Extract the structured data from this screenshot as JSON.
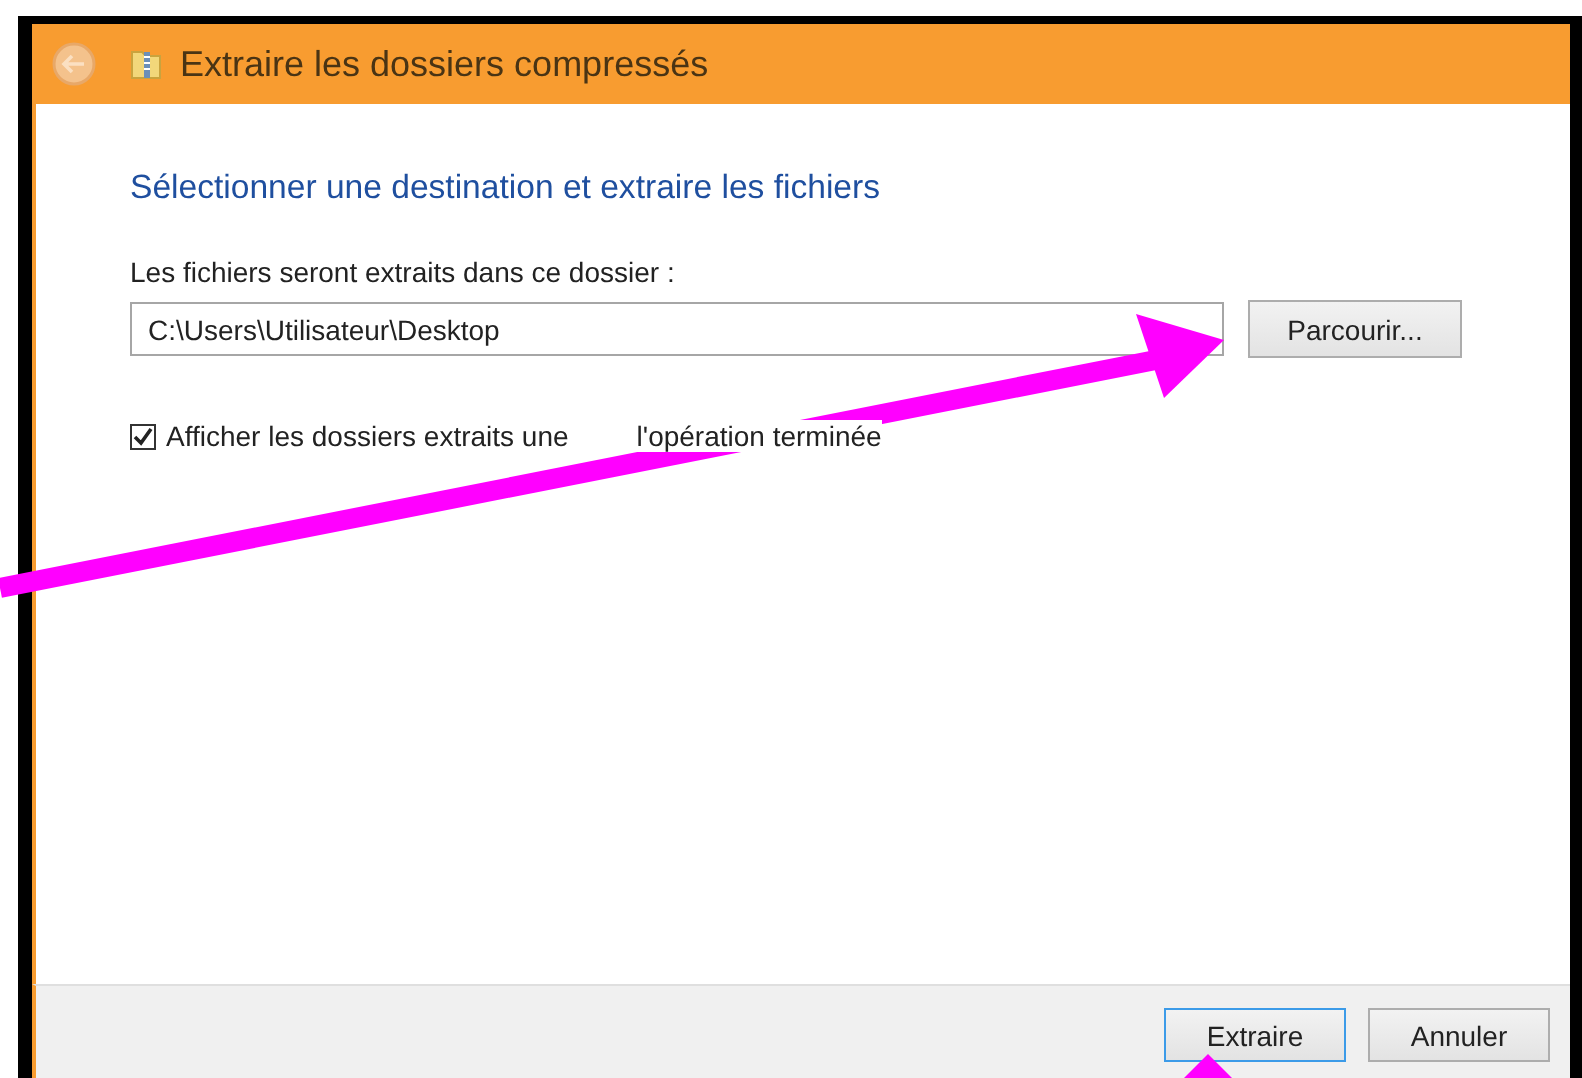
{
  "window": {
    "title": "Extraire les dossiers compressés",
    "back_disabled": true
  },
  "heading": "Sélectionner une destination et extraire les fichiers",
  "destination": {
    "label": "Les fichiers seront extraits dans ce dossier :",
    "value": "C:\\Users\\Utilisateur\\Desktop"
  },
  "browse_button": "Parcourir...",
  "show_folders": {
    "label_start": "Afficher les dossiers extraits une",
    "label_end": "l'opération terminée",
    "checked": true
  },
  "buttons": [
    {
      "label": "Extraire",
      "default": true
    },
    {
      "label": "Annuler",
      "default": false
    }
  ]
}
